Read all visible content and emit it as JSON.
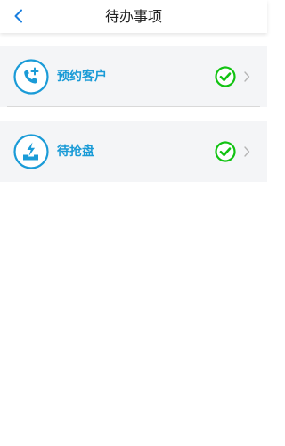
{
  "header": {
    "title": "待办事项",
    "back_icon": "chevron-left-icon"
  },
  "items": [
    {
      "label": "预约客户",
      "icon": "phone-add-icon",
      "status_icon": "check-circle-icon",
      "arrow_icon": "chevron-right-icon"
    },
    {
      "label": "待抢盘",
      "icon": "lightning-icon",
      "status_icon": "check-circle-icon",
      "arrow_icon": "chevron-right-icon"
    }
  ],
  "colors": {
    "accent_blue": "#1a9bd7",
    "back_blue": "#1a7fe0",
    "check_green": "#12c312",
    "card_bg": "#f4f5f7",
    "chevron_gray": "#b5b5b5"
  }
}
